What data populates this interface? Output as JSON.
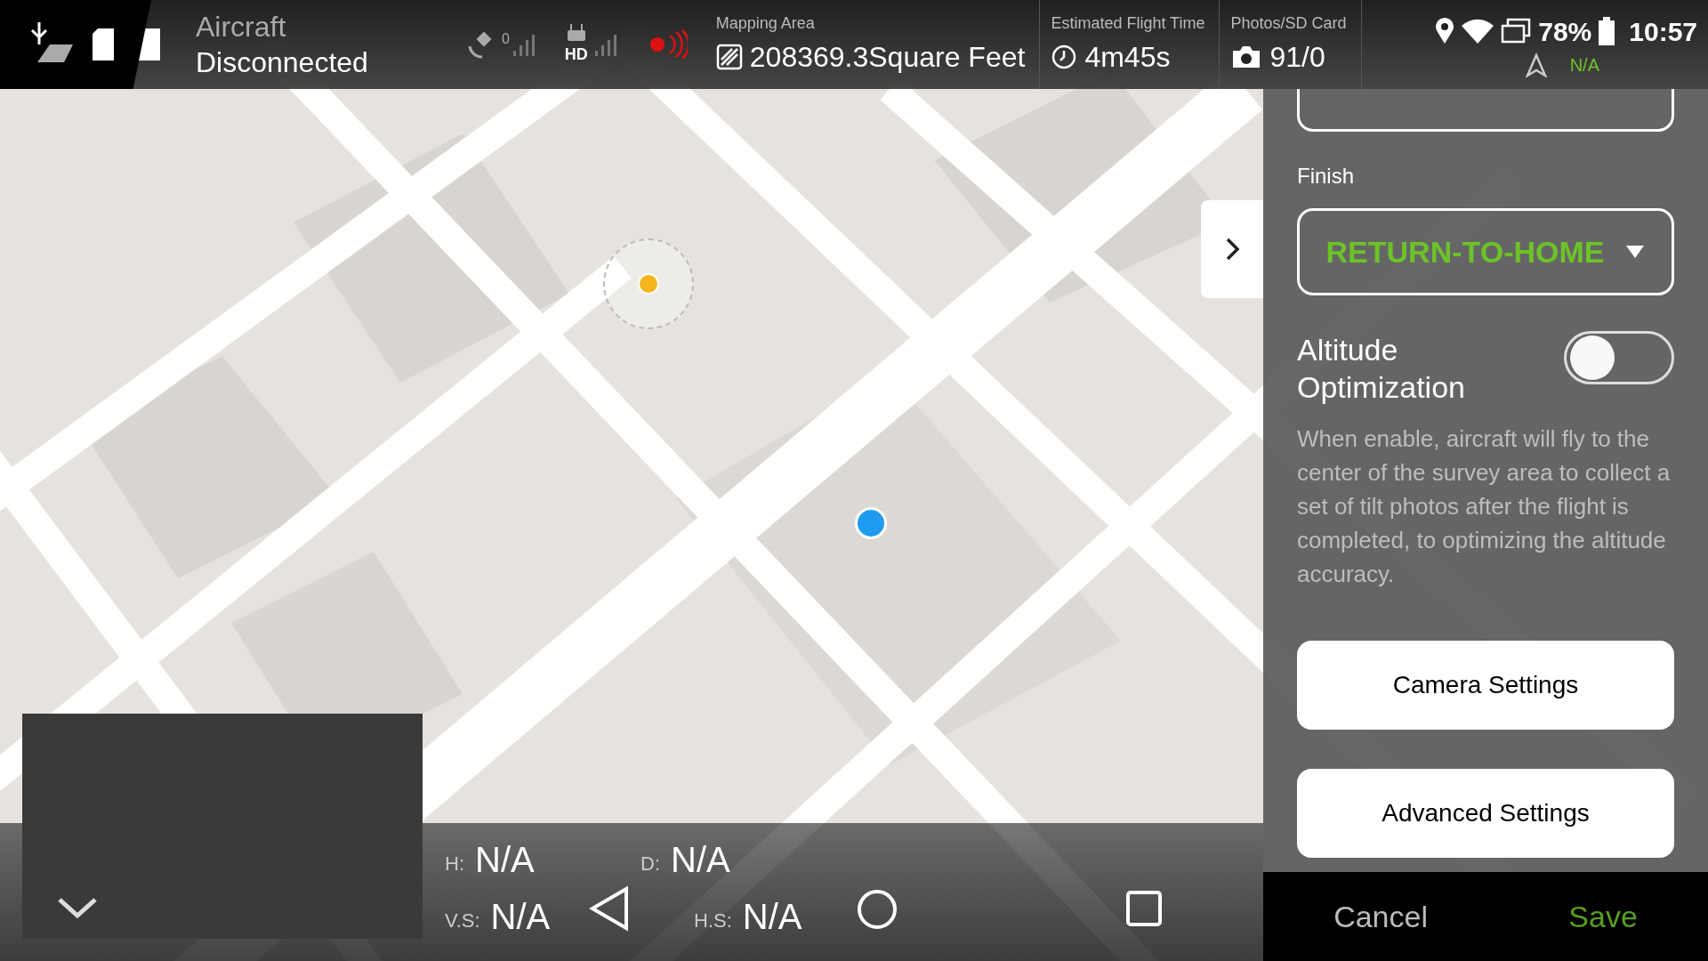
{
  "top_bar": {
    "aircraft_status": [
      "Aircraft",
      "Disconnected"
    ],
    "satellites": "0",
    "video_link": "HD",
    "stats": [
      {
        "label": "Mapping Area",
        "value": "208369.3Square Feet",
        "kind": "area"
      },
      {
        "label": "Estimated Flight Time",
        "value": "4m45s",
        "kind": "time"
      },
      {
        "label": "Photos/SD Card",
        "value": "91/0",
        "kind": "photos"
      }
    ],
    "rtk": "N/A",
    "battery": "78%",
    "clock": "10:57"
  },
  "telemetry": [
    {
      "label": "H:",
      "value": "N/A"
    },
    {
      "label": "D:",
      "value": "N/A"
    },
    {
      "label": "V.S:",
      "value": "N/A"
    },
    {
      "label": "H.S:",
      "value": "N/A"
    }
  ],
  "panel": {
    "finish_label": "Finish",
    "finish_value": "RETURN-TO-HOME",
    "altitude": {
      "label": "Altitude Optimization",
      "on": false,
      "description": "When enable, aircraft will fly to the center of the survey area to collect a set of tilt photos after the flight is completed, to optimizing the altitude accuracy."
    },
    "buttons": [
      "Camera Settings",
      "Advanced Settings"
    ],
    "cancel": "Cancel",
    "save": "Save"
  }
}
